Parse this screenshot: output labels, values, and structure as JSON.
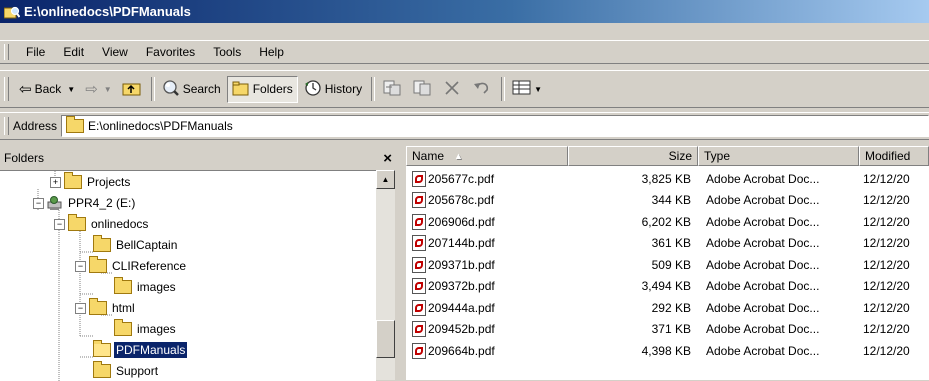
{
  "window": {
    "title": "E:\\onlinedocs\\PDFManuals",
    "icon": "explorer-search-icon"
  },
  "menu": [
    "File",
    "Edit",
    "View",
    "Favorites",
    "Tools",
    "Help"
  ],
  "toolbar": {
    "back_label": "Back",
    "search_label": "Search",
    "folders_label": "Folders",
    "history_label": "History"
  },
  "address": {
    "label": "Address",
    "value": "E:\\onlinedocs\\PDFManuals"
  },
  "folders_pane": {
    "title": "Folders",
    "close_glyph": "×",
    "tree": [
      {
        "label": "Projects",
        "expander": "+",
        "icon": "folder",
        "indent": 0
      },
      {
        "label": "PPR4_2 (E:)",
        "expander": "−",
        "icon": "drive",
        "indent": -1
      },
      {
        "label": "onlinedocs",
        "expander": "−",
        "icon": "folder",
        "indent": 1
      },
      {
        "label": "BellCaptain",
        "expander": "",
        "icon": "folder",
        "indent": 2
      },
      {
        "label": "CLIReference",
        "expander": "−",
        "icon": "folder",
        "indent": 2
      },
      {
        "label": "images",
        "expander": "",
        "icon": "folder",
        "indent": 3
      },
      {
        "label": "html",
        "expander": "−",
        "icon": "folder",
        "indent": 2
      },
      {
        "label": "images",
        "expander": "",
        "icon": "folder",
        "indent": 3
      },
      {
        "label": "PDFManuals",
        "expander": "",
        "icon": "folder-open",
        "indent": 2,
        "selected": true
      },
      {
        "label": "Support",
        "expander": "",
        "icon": "folder",
        "indent": 2
      }
    ]
  },
  "file_list": {
    "columns": {
      "name": "Name",
      "size": "Size",
      "type": "Type",
      "modified": "Modified"
    },
    "sort_indicator": "▲",
    "rows": [
      {
        "name": "205677c.pdf",
        "size": "3,825 KB",
        "type": "Adobe Acrobat Doc...",
        "modified": "12/12/20"
      },
      {
        "name": "205678c.pdf",
        "size": "344 KB",
        "type": "Adobe Acrobat Doc...",
        "modified": "12/12/20"
      },
      {
        "name": "206906d.pdf",
        "size": "6,202 KB",
        "type": "Adobe Acrobat Doc...",
        "modified": "12/12/20"
      },
      {
        "name": "207144b.pdf",
        "size": "361 KB",
        "type": "Adobe Acrobat Doc...",
        "modified": "12/12/20"
      },
      {
        "name": "209371b.pdf",
        "size": "509 KB",
        "type": "Adobe Acrobat Doc...",
        "modified": "12/12/20"
      },
      {
        "name": "209372b.pdf",
        "size": "3,494 KB",
        "type": "Adobe Acrobat Doc...",
        "modified": "12/12/20"
      },
      {
        "name": "209444a.pdf",
        "size": "292 KB",
        "type": "Adobe Acrobat Doc...",
        "modified": "12/12/20"
      },
      {
        "name": "209452b.pdf",
        "size": "371 KB",
        "type": "Adobe Acrobat Doc...",
        "modified": "12/12/20"
      },
      {
        "name": "209664b.pdf",
        "size": "4,398 KB",
        "type": "Adobe Acrobat Doc...",
        "modified": "12/12/20"
      }
    ]
  },
  "colors": {
    "title_active": "#0a246a",
    "title_gradient_end": "#a6caf0",
    "face": "#d4d0c8",
    "selection": "#0a246a"
  }
}
